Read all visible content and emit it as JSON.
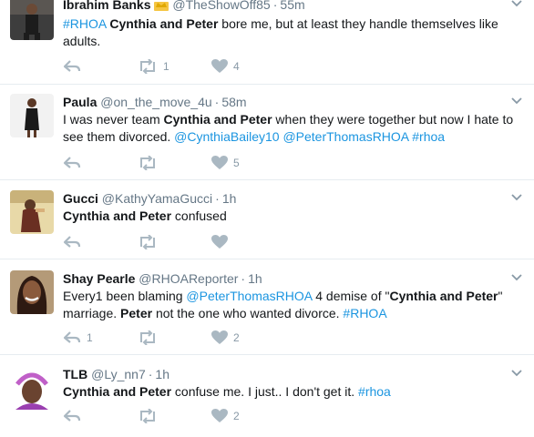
{
  "tweets": [
    {
      "name": "Ibrahim Banks",
      "handle": "@TheShowOff85",
      "time": "55m",
      "text": [
        {
          "t": "#RHOA",
          "k": "link"
        },
        {
          "t": " "
        },
        {
          "t": "Cynthia and Peter",
          "k": "bold"
        },
        {
          "t": " bore me, but at least they handle themselves like adults."
        }
      ],
      "retweets": "1",
      "likes": "4"
    },
    {
      "name": "Paula",
      "handle": "@on_the_move_4u",
      "time": "58m",
      "text": [
        {
          "t": "I was never team "
        },
        {
          "t": "Cynthia and Peter",
          "k": "bold"
        },
        {
          "t": " when they were together but now I hate to see them divorced. "
        },
        {
          "t": "@CynthiaBailey10",
          "k": "link"
        },
        {
          "t": " "
        },
        {
          "t": "@PeterThomasRHOA",
          "k": "link"
        },
        {
          "t": " "
        },
        {
          "t": "#rhoa",
          "k": "link"
        }
      ],
      "retweets": "",
      "likes": "5"
    },
    {
      "name": "Gucci",
      "handle": "@KathyYamaGucci",
      "time": "1h",
      "text": [
        {
          "t": "Cynthia and Peter",
          "k": "bold"
        },
        {
          "t": " confused"
        }
      ],
      "retweets": "",
      "likes": ""
    },
    {
      "name": "Shay Pearle",
      "handle": "@RHOAReporter",
      "time": "1h",
      "text": [
        {
          "t": "Every1 been blaming "
        },
        {
          "t": "@PeterThomasRHOA",
          "k": "link"
        },
        {
          "t": " 4 demise of \""
        },
        {
          "t": "Cynthia and Peter",
          "k": "bold"
        },
        {
          "t": "\" marriage. "
        },
        {
          "t": "Peter",
          "k": "bold"
        },
        {
          "t": " not the one who wanted divorce. "
        },
        {
          "t": "#RHOA",
          "k": "link"
        }
      ],
      "replies": "1",
      "retweets": "",
      "likes": "2"
    },
    {
      "name": "TLB",
      "handle": "@Ly_nn7",
      "time": "1h",
      "text": [
        {
          "t": "Cynthia and Peter",
          "k": "bold"
        },
        {
          "t": " confuse me. I just.. I don't get it.  "
        },
        {
          "t": "#rhoa",
          "k": "link"
        }
      ],
      "retweets": "",
      "likes": "2"
    }
  ],
  "colors": {
    "link": "#1b95e0",
    "meta": "#657786",
    "icon": "#aab8c2"
  }
}
